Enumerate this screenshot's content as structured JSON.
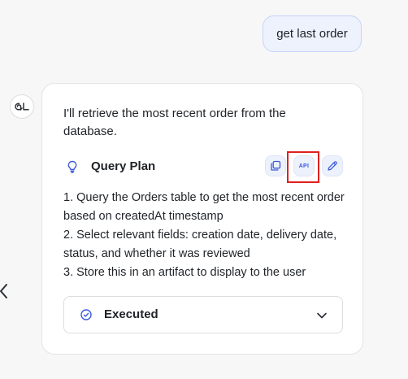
{
  "user_message": {
    "text": "get last order"
  },
  "assistant": {
    "avatar_icon": "ql-logo-icon",
    "intro_text": "I'll retrieve the most recent order from the database.",
    "query_plan": {
      "title": "Query Plan",
      "title_icon": "lightbulb-icon",
      "actions": {
        "copy_icon": "copy-icon",
        "api_label": "API",
        "edit_icon": "pencil-icon"
      },
      "steps": [
        "1. Query the Orders table to get the most recent order based on createdAt timestamp",
        "2. Select relevant fields: creation date, delivery date, status, and whether it was reviewed",
        "3. Store this in an artifact to display to the user"
      ]
    },
    "status": {
      "label": "Executed",
      "icon": "check-circle-icon",
      "expand_icon": "chevron-down-icon"
    }
  },
  "colors": {
    "accent": "#3a5bd9",
    "user_bubble_bg": "#eef2fd",
    "user_bubble_border": "#c8d4f5",
    "highlight": "#e0201f"
  }
}
